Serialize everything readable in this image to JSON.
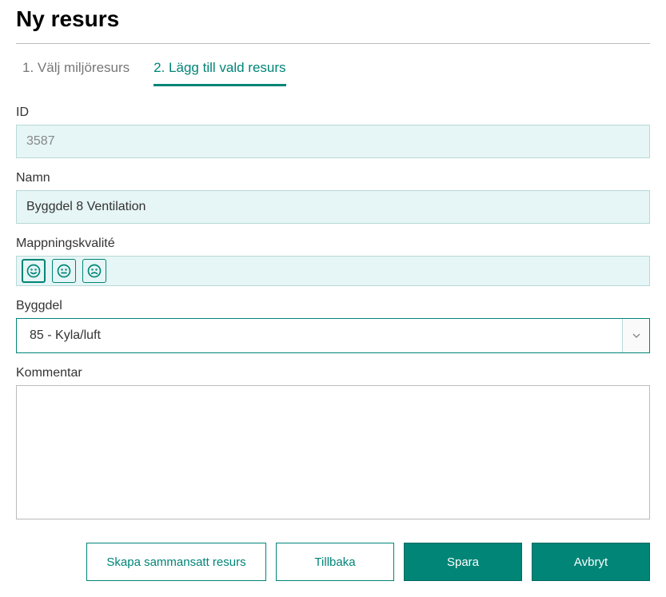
{
  "title": "Ny resurs",
  "tabs": {
    "tab1": "1. Välj miljöresurs",
    "tab2": "2. Lägg till vald resurs"
  },
  "fields": {
    "idLabel": "ID",
    "idValue": "3587",
    "namnLabel": "Namn",
    "namnValue": "Byggdel 8 Ventilation",
    "qualityLabel": "Mappningskvalité",
    "byggdelLabel": "Byggdel",
    "byggdelValue": "85 - Kyla/luft",
    "kommentarLabel": "Kommentar",
    "kommentarValue": ""
  },
  "buttons": {
    "skapa": "Skapa sammansatt resurs",
    "tillbaka": "Tillbaka",
    "spara": "Spara",
    "avbryt": "Avbryt"
  }
}
